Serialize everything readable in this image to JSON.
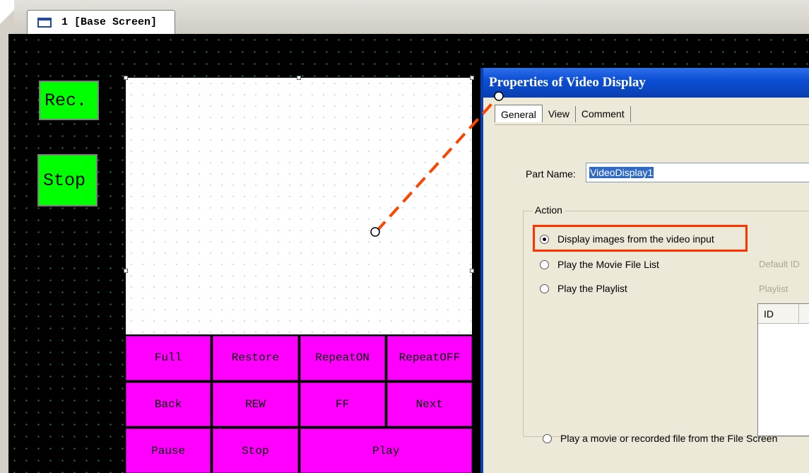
{
  "tab": {
    "label": "1 [Base Screen]"
  },
  "side_buttons": {
    "rec_label": "Rec.",
    "stop_label": "Stop"
  },
  "panel_buttons": [
    "Full",
    "Restore",
    "RepeatON",
    "RepeatOFF",
    "Back",
    "REW",
    "FF",
    "Next",
    "Pause",
    "Stop",
    "Play"
  ],
  "dialog": {
    "title": "Properties of Video Display",
    "tabs": [
      "General",
      "View",
      "Comment"
    ],
    "part_name_label": "Part Name:",
    "part_name_value": "VideoDisplay1",
    "action_label": "Action",
    "options": {
      "video_input": "Display images from the video input",
      "movie_list": "Play the Movie File List",
      "playlist": "Play the Playlist",
      "file_screen": "Play a movie or recorded file from the File Screen"
    },
    "default_id_label": "Default ID",
    "playlist_label": "Playlist",
    "table_col_id": "ID"
  },
  "colors": {
    "side_button": "#00ff00",
    "panel_button": "#ff00ff",
    "highlight": "#ff3300",
    "arrow": "#ff4400",
    "titlebar": "#0b4fd6"
  }
}
